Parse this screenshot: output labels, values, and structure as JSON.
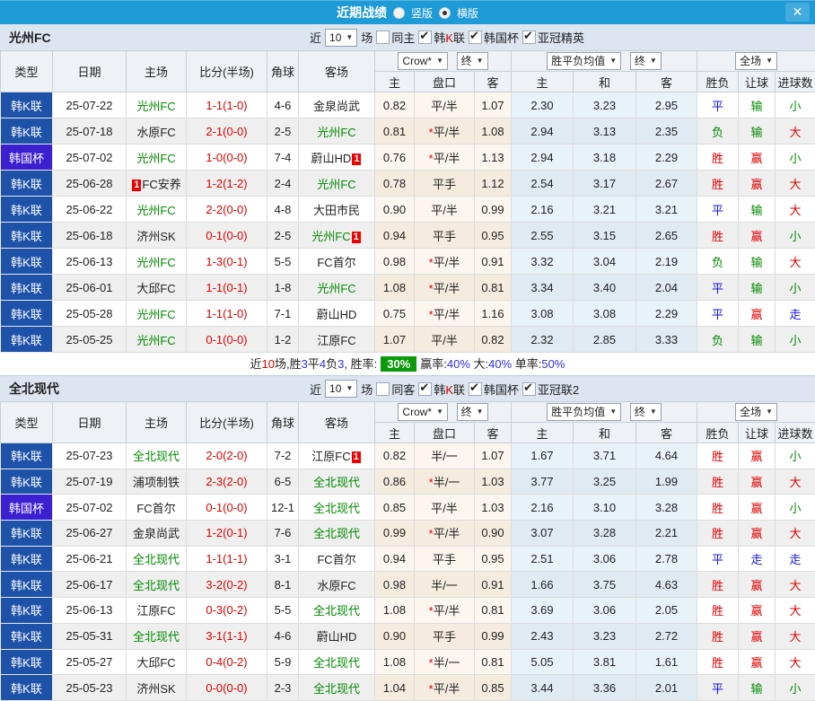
{
  "icons": {
    "chevron_down": "▼",
    "check": "✔",
    "close": "✕"
  },
  "colors": {
    "titlebar_blue": "#1e9ad6",
    "league_cell_blue": "#1e52a8",
    "cup_cell_purple": "#3d1fd2",
    "win_red": "#e00000",
    "draw_blue": "#1414dc",
    "lose_green": "#008a00",
    "self_team_green": "#008a00",
    "score_red": "#e00000",
    "badge_red": "#ee0000",
    "rate_badge_green": "#0a9a0a",
    "section_head_bg": "#dce5f0",
    "odds_col_bg": "#fcf6ee",
    "avg_col_bg": "#e8f2f9"
  },
  "titlebar": {
    "title": "近期战绩",
    "radio_vertical_label": "竖版",
    "radio_horizontal_label": "横版",
    "selected_layout": "横版"
  },
  "columns": {
    "type": "类型",
    "date": "日期",
    "home": "主场",
    "score": "比分(半场)",
    "corner": "角球",
    "away": "客场",
    "odds_home": "主",
    "odds_line": "盘口",
    "odds_away": "客",
    "avg_home": "主",
    "avg_draw": "和",
    "avg_away": "客",
    "result_wdl": "胜负",
    "result_handicap": "让球",
    "result_goals": "进球数"
  },
  "dropdowns": {
    "odds_source": "Crow*",
    "odds_time": "终",
    "avg": "胜平负均值",
    "avg_time": "终",
    "scope": "全场"
  },
  "sections": [
    {
      "team": "光州FC",
      "filters": {
        "near_label": "近",
        "count": "10",
        "games_label": "场",
        "same_label": "同主",
        "same_checked": false,
        "league_k_pre": "韩",
        "league_k_mid": "K",
        "league_k_post": "联",
        "league_cup": "韩国杯",
        "league_third": "亚冠精英"
      },
      "rows": [
        {
          "t": "韩K联",
          "d": "25-07-22",
          "h": {
            "n": "光州FC",
            "self": 1
          },
          "s": "1-1(1-0)",
          "c": "4-6",
          "a": {
            "n": "金泉尚武"
          },
          "o": [
            "0.82",
            "平/半",
            "1.07"
          ],
          "v": [
            "2.30",
            "3.23",
            "2.95"
          ],
          "r": [
            "平",
            "输",
            "小"
          ]
        },
        {
          "t": "韩K联",
          "d": "25-07-18",
          "h": {
            "n": "水原FC"
          },
          "s": "2-1(0-0)",
          "c": "2-5",
          "a": {
            "n": "光州FC",
            "self": 1
          },
          "o": [
            "0.81",
            "*平/半",
            "1.08"
          ],
          "v": [
            "2.94",
            "3.13",
            "2.35"
          ],
          "r": [
            "负",
            "输",
            "大"
          ]
        },
        {
          "t": "韩国杯",
          "d": "25-07-02",
          "h": {
            "n": "光州FC",
            "self": 1
          },
          "s": "1-0(0-0)",
          "c": "7-4",
          "a": {
            "n": "蔚山HD",
            "b": "1",
            "bp": "after"
          },
          "o": [
            "0.76",
            "*平/半",
            "1.13"
          ],
          "v": [
            "2.94",
            "3.18",
            "2.29"
          ],
          "r": [
            "胜",
            "赢",
            "小"
          ]
        },
        {
          "t": "韩K联",
          "d": "25-06-28",
          "h": {
            "n": "FC安养",
            "b": "1",
            "bp": "before"
          },
          "s": "1-2(1-2)",
          "c": "2-4",
          "a": {
            "n": "光州FC",
            "self": 1
          },
          "o": [
            "0.78",
            "平手",
            "1.12"
          ],
          "v": [
            "2.54",
            "3.17",
            "2.67"
          ],
          "r": [
            "胜",
            "赢",
            "大"
          ]
        },
        {
          "t": "韩K联",
          "d": "25-06-22",
          "h": {
            "n": "光州FC",
            "self": 1
          },
          "s": "2-2(0-0)",
          "c": "4-8",
          "a": {
            "n": "大田市民"
          },
          "o": [
            "0.90",
            "平/半",
            "0.99"
          ],
          "v": [
            "2.16",
            "3.21",
            "3.21"
          ],
          "r": [
            "平",
            "输",
            "大"
          ]
        },
        {
          "t": "韩K联",
          "d": "25-06-18",
          "h": {
            "n": "济州SK"
          },
          "s": "0-1(0-0)",
          "c": "2-5",
          "a": {
            "n": "光州FC",
            "self": 1,
            "b": "1",
            "bp": "after"
          },
          "o": [
            "0.94",
            "平手",
            "0.95"
          ],
          "v": [
            "2.55",
            "3.15",
            "2.65"
          ],
          "r": [
            "胜",
            "赢",
            "小"
          ]
        },
        {
          "t": "韩K联",
          "d": "25-06-13",
          "h": {
            "n": "光州FC",
            "self": 1
          },
          "s": "1-3(0-1)",
          "c": "5-5",
          "a": {
            "n": "FC首尔"
          },
          "o": [
            "0.98",
            "*平/半",
            "0.91"
          ],
          "v": [
            "3.32",
            "3.04",
            "2.19"
          ],
          "r": [
            "负",
            "输",
            "大"
          ]
        },
        {
          "t": "韩K联",
          "d": "25-06-01",
          "h": {
            "n": "大邱FC"
          },
          "s": "1-1(0-1)",
          "c": "1-8",
          "a": {
            "n": "光州FC",
            "self": 1
          },
          "o": [
            "1.08",
            "*平/半",
            "0.81"
          ],
          "v": [
            "3.34",
            "3.40",
            "2.04"
          ],
          "r": [
            "平",
            "输",
            "小"
          ]
        },
        {
          "t": "韩K联",
          "d": "25-05-28",
          "h": {
            "n": "光州FC",
            "self": 1
          },
          "s": "1-1(1-0)",
          "c": "7-1",
          "a": {
            "n": "蔚山HD"
          },
          "o": [
            "0.75",
            "*平/半",
            "1.16"
          ],
          "v": [
            "3.08",
            "3.08",
            "2.29"
          ],
          "r": [
            "平",
            "赢",
            "走"
          ]
        },
        {
          "t": "韩K联",
          "d": "25-05-25",
          "h": {
            "n": "光州FC",
            "self": 1
          },
          "s": "0-1(0-0)",
          "c": "1-2",
          "a": {
            "n": "江原FC"
          },
          "o": [
            "1.07",
            "平/半",
            "0.82"
          ],
          "v": [
            "2.32",
            "2.85",
            "3.33"
          ],
          "r": [
            "负",
            "输",
            "小"
          ]
        }
      ],
      "summary": {
        "parts": [
          {
            "t": "近",
            "c": "k"
          },
          {
            "t": "10",
            "c": "red"
          },
          {
            "t": "场,胜",
            "c": "k"
          },
          {
            "t": "3",
            "c": "blue"
          },
          {
            "t": "平",
            "c": "k"
          },
          {
            "t": "4",
            "c": "blue"
          },
          {
            "t": "负",
            "c": "k"
          },
          {
            "t": "3",
            "c": "blue"
          },
          {
            "t": ", 胜率:",
            "c": "k"
          },
          {
            "t": "30%",
            "c": "badge"
          },
          {
            "t": "赢率:",
            "c": "k"
          },
          {
            "t": "40%",
            "c": "blue"
          },
          {
            "t": " 大:",
            "c": "k"
          },
          {
            "t": "40%",
            "c": "blue"
          },
          {
            "t": " 单率:",
            "c": "k"
          },
          {
            "t": "50%",
            "c": "blue"
          }
        ]
      }
    },
    {
      "team": "全北现代",
      "filters": {
        "near_label": "近",
        "count": "10",
        "games_label": "场",
        "same_label": "同客",
        "same_checked": false,
        "league_k_pre": "韩",
        "league_k_mid": "K",
        "league_k_post": "联",
        "league_cup": "韩国杯",
        "league_third": "亚冠联2"
      },
      "rows": [
        {
          "t": "韩K联",
          "d": "25-07-23",
          "h": {
            "n": "全北现代",
            "self": 1
          },
          "s": "2-0(2-0)",
          "c": "7-2",
          "a": {
            "n": "江原FC",
            "b": "1",
            "bp": "after"
          },
          "o": [
            "0.82",
            "半/一",
            "1.07"
          ],
          "v": [
            "1.67",
            "3.71",
            "4.64"
          ],
          "r": [
            "胜",
            "赢",
            "小"
          ]
        },
        {
          "t": "韩K联",
          "d": "25-07-19",
          "h": {
            "n": "浦项制铁"
          },
          "s": "2-3(2-0)",
          "c": "6-5",
          "a": {
            "n": "全北现代",
            "self": 1
          },
          "o": [
            "0.86",
            "*半/一",
            "1.03"
          ],
          "v": [
            "3.77",
            "3.25",
            "1.99"
          ],
          "r": [
            "胜",
            "赢",
            "大"
          ]
        },
        {
          "t": "韩国杯",
          "d": "25-07-02",
          "h": {
            "n": "FC首尔"
          },
          "s": "0-1(0-0)",
          "c": "12-1",
          "a": {
            "n": "全北现代",
            "self": 1
          },
          "o": [
            "0.85",
            "平/半",
            "1.03"
          ],
          "v": [
            "2.16",
            "3.10",
            "3.28"
          ],
          "r": [
            "胜",
            "赢",
            "小"
          ]
        },
        {
          "t": "韩K联",
          "d": "25-06-27",
          "h": {
            "n": "金泉尚武"
          },
          "s": "1-2(0-1)",
          "c": "7-6",
          "a": {
            "n": "全北现代",
            "self": 1
          },
          "o": [
            "0.99",
            "*平/半",
            "0.90"
          ],
          "v": [
            "3.07",
            "3.28",
            "2.21"
          ],
          "r": [
            "胜",
            "赢",
            "大"
          ]
        },
        {
          "t": "韩K联",
          "d": "25-06-21",
          "h": {
            "n": "全北现代",
            "self": 1
          },
          "s": "1-1(1-1)",
          "c": "3-1",
          "a": {
            "n": "FC首尔"
          },
          "o": [
            "0.94",
            "平手",
            "0.95"
          ],
          "v": [
            "2.51",
            "3.06",
            "2.78"
          ],
          "r": [
            "平",
            "走",
            "走"
          ]
        },
        {
          "t": "韩K联",
          "d": "25-06-17",
          "h": {
            "n": "全北现代",
            "self": 1
          },
          "s": "3-2(0-2)",
          "c": "8-1",
          "a": {
            "n": "水原FC"
          },
          "o": [
            "0.98",
            "半/一",
            "0.91"
          ],
          "v": [
            "1.66",
            "3.75",
            "4.63"
          ],
          "r": [
            "胜",
            "赢",
            "大"
          ]
        },
        {
          "t": "韩K联",
          "d": "25-06-13",
          "h": {
            "n": "江原FC"
          },
          "s": "0-3(0-2)",
          "c": "5-5",
          "a": {
            "n": "全北现代",
            "self": 1
          },
          "o": [
            "1.08",
            "*平/半",
            "0.81"
          ],
          "v": [
            "3.69",
            "3.06",
            "2.05"
          ],
          "r": [
            "胜",
            "赢",
            "大"
          ]
        },
        {
          "t": "韩K联",
          "d": "25-05-31",
          "h": {
            "n": "全北现代",
            "self": 1
          },
          "s": "3-1(1-1)",
          "c": "4-6",
          "a": {
            "n": "蔚山HD"
          },
          "o": [
            "0.90",
            "平手",
            "0.99"
          ],
          "v": [
            "2.43",
            "3.23",
            "2.72"
          ],
          "r": [
            "胜",
            "赢",
            "大"
          ]
        },
        {
          "t": "韩K联",
          "d": "25-05-27",
          "h": {
            "n": "大邱FC"
          },
          "s": "0-4(0-2)",
          "c": "5-9",
          "a": {
            "n": "全北现代",
            "self": 1
          },
          "o": [
            "1.08",
            "*半/一",
            "0.81"
          ],
          "v": [
            "5.05",
            "3.81",
            "1.61"
          ],
          "r": [
            "胜",
            "赢",
            "大"
          ]
        },
        {
          "t": "韩K联",
          "d": "25-05-23",
          "h": {
            "n": "济州SK"
          },
          "s": "0-0(0-0)",
          "c": "2-3",
          "a": {
            "n": "全北现代",
            "self": 1
          },
          "o": [
            "1.04",
            "*平/半",
            "0.85"
          ],
          "v": [
            "3.44",
            "3.36",
            "2.01"
          ],
          "r": [
            "平",
            "输",
            "小"
          ]
        }
      ],
      "summary": null
    }
  ]
}
